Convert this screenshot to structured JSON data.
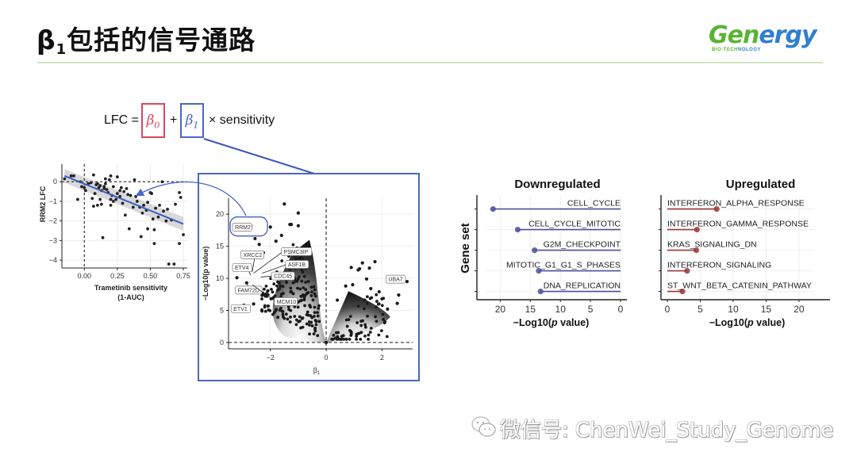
{
  "slide": {
    "title_symbol": "β",
    "title_subscript": "1",
    "title_text": "包括的信号通路",
    "logo": {
      "word_part1": "Gen",
      "word_part2": "ergy",
      "tagline_part1": "BIO-TECH",
      "tagline_part2": "NOLOGY",
      "green": "#5bb234",
      "blue": "#2f7fd0"
    },
    "formula": {
      "lhs": "LFC =",
      "beta0": "β",
      "beta0_sub": "0",
      "plus": "+",
      "beta1": "β",
      "beta1_sub": "1",
      "rhs": "× sensitivity",
      "beta0_color": "#e0455b",
      "beta1_color": "#4a67c4"
    },
    "watermark": "微信号: ChenWei_Study_Genome",
    "watermark_icon": "wechat-icon"
  },
  "chart_data": [
    {
      "id": "scatter",
      "type": "scatter",
      "title": "",
      "xlabel": "Trametinib sensitivity",
      "xlabel2": "(1-AUC)",
      "ylabel": "RRM2 LFC",
      "xlim": [
        -0.17,
        0.78
      ],
      "ylim": [
        -4.4,
        0.9
      ],
      "xticks": [
        "0.00",
        "0.25",
        "0.50",
        "0.75"
      ],
      "xtick_values": [
        0,
        0.25,
        0.5,
        0.75
      ],
      "yticks": [
        "0",
        "−1",
        "−2",
        "−3",
        "−4"
      ],
      "ytick_values": [
        0,
        -1,
        -2,
        -3,
        -4
      ],
      "reference_lines": {
        "x": 0,
        "y": 0
      },
      "fit_line": {
        "x0": -0.15,
        "y0": 0.3,
        "x1": 0.75,
        "y1": -2.15,
        "color": "#3c5fc0"
      },
      "points": [
        [
          -0.15,
          0.15
        ],
        [
          -0.1,
          0.3
        ],
        [
          -0.08,
          0.3
        ],
        [
          -0.05,
          -0.9
        ],
        [
          -0.03,
          0.0
        ],
        [
          0.0,
          -0.3
        ],
        [
          0.01,
          -0.45
        ],
        [
          0.03,
          -0.1
        ],
        [
          0.05,
          -0.05
        ],
        [
          0.06,
          -0.85
        ],
        [
          0.07,
          0.35
        ],
        [
          0.07,
          -1.25
        ],
        [
          0.08,
          -0.6
        ],
        [
          0.09,
          -0.15
        ],
        [
          0.1,
          -1.2
        ],
        [
          0.1,
          -0.1
        ],
        [
          0.11,
          -0.3
        ],
        [
          0.12,
          -0.2
        ],
        [
          0.12,
          -0.9
        ],
        [
          0.13,
          -1.15
        ],
        [
          0.13,
          -0.45
        ],
        [
          0.14,
          -2.85
        ],
        [
          0.15,
          -0.25
        ],
        [
          0.15,
          -0.35
        ],
        [
          0.16,
          0.15
        ],
        [
          0.16,
          -0.1
        ],
        [
          0.17,
          -0.4
        ],
        [
          0.18,
          -0.55
        ],
        [
          0.19,
          0.1
        ],
        [
          0.2,
          -0.9
        ],
        [
          0.2,
          -1.2
        ],
        [
          0.2,
          0.3
        ],
        [
          0.21,
          -0.7
        ],
        [
          0.22,
          -1.0
        ],
        [
          0.22,
          -0.25
        ],
        [
          0.24,
          -0.9
        ],
        [
          0.25,
          0.25
        ],
        [
          0.25,
          -0.6
        ],
        [
          0.27,
          -0.45
        ],
        [
          0.27,
          -0.75
        ],
        [
          0.28,
          -0.3
        ],
        [
          0.29,
          -1.1
        ],
        [
          0.3,
          -0.5
        ],
        [
          0.31,
          -1.7
        ],
        [
          0.32,
          -0.35
        ],
        [
          0.33,
          -0.65
        ],
        [
          0.34,
          -2.4
        ],
        [
          0.35,
          -0.7
        ],
        [
          0.37,
          -1.3
        ],
        [
          0.38,
          0.1
        ],
        [
          0.39,
          -0.75
        ],
        [
          0.4,
          -1.0
        ],
        [
          0.42,
          -1.3
        ],
        [
          0.43,
          -2.8
        ],
        [
          0.44,
          -1.6
        ],
        [
          0.45,
          -1.2
        ],
        [
          0.47,
          -1.45
        ],
        [
          0.48,
          -2.4
        ],
        [
          0.48,
          -1.05
        ],
        [
          0.5,
          -0.55
        ],
        [
          0.51,
          -0.6
        ],
        [
          0.52,
          -1.9
        ],
        [
          0.53,
          -3.15
        ],
        [
          0.53,
          -2.45
        ],
        [
          0.54,
          -1.35
        ],
        [
          0.56,
          -1.8
        ],
        [
          0.57,
          -1.2
        ],
        [
          0.59,
          0.0
        ],
        [
          0.6,
          -1.5
        ],
        [
          0.62,
          -2.0
        ],
        [
          0.63,
          -1.4
        ],
        [
          0.64,
          -4.2
        ],
        [
          0.66,
          -1.95
        ],
        [
          0.68,
          -4.2
        ],
        [
          0.69,
          -1.15
        ],
        [
          0.72,
          -0.55
        ],
        [
          0.72,
          -3.15
        ],
        [
          0.73,
          -0.8
        ],
        [
          0.75,
          -2.7
        ],
        [
          -0.02,
          -0.25
        ]
      ]
    },
    {
      "id": "volcano",
      "type": "scatter",
      "title": "",
      "xlabel": "β",
      "xlabel_sub": "1",
      "ylabel": "−Log10(p value)",
      "xlim": [
        -3.5,
        3.1
      ],
      "ylim": [
        -1.0,
        22.5
      ],
      "xticks": [
        "−2",
        "0",
        "2"
      ],
      "xtick_values": [
        -2,
        0,
        2
      ],
      "yticks": [
        "0",
        "5",
        "10",
        "15",
        "20"
      ],
      "ytick_values": [
        0,
        5,
        10,
        15,
        20
      ],
      "reference_lines": {
        "x": 0,
        "y": 0
      },
      "highlight": {
        "label": "RRM2",
        "color": "#4a67c4"
      },
      "labels": [
        {
          "text": "RRM2",
          "x": -2.7,
          "y": 18.2,
          "lx": -3.3,
          "ly": 17.6
        },
        {
          "text": "XRCC2",
          "x": -2.65,
          "y": 11.0,
          "lx": -3.0,
          "ly": 13.3
        },
        {
          "text": "PSMC3IP",
          "x": -2.6,
          "y": 10.8,
          "lx": -1.55,
          "ly": 13.8
        },
        {
          "text": "ETV4",
          "x": -2.7,
          "y": 10.5,
          "lx": -3.3,
          "ly": 11.3
        },
        {
          "text": "ASF1B",
          "x": -2.3,
          "y": 10.8,
          "lx": -1.4,
          "ly": 11.8
        },
        {
          "text": "CDC45",
          "x": -2.35,
          "y": 10.2,
          "lx": -1.9,
          "ly": 10.0
        },
        {
          "text": "FAM72D",
          "x": -2.85,
          "y": 9.3,
          "lx": -3.2,
          "ly": 7.8
        },
        {
          "text": "MCM10",
          "x": -2.65,
          "y": 9.0,
          "lx": -1.8,
          "ly": 6.0
        },
        {
          "text": "ETV1",
          "x": -2.95,
          "y": 5.8,
          "lx": -3.35,
          "ly": 4.9
        },
        {
          "text": "UBA7",
          "x": 2.85,
          "y": 9.5,
          "lx": 2.2,
          "ly": 9.5
        }
      ],
      "outlier_points": [
        [
          -1.5,
          21.6
        ],
        [
          -1.0,
          20.2
        ],
        [
          -2.7,
          18.2
        ],
        [
          -2.0,
          18.0
        ],
        [
          -1.3,
          18.4
        ],
        [
          -1.25,
          18.4
        ],
        [
          -1.0,
          18.2
        ],
        [
          -2.55,
          16.2
        ],
        [
          -1.6,
          16.7
        ],
        [
          -2.4,
          15.3
        ],
        [
          -1.8,
          15.8
        ],
        [
          -2.25,
          14.0
        ],
        [
          -3.2,
          10.1
        ],
        [
          -2.95,
          5.8
        ],
        [
          -2.85,
          9.3
        ],
        [
          -2.6,
          6.0
        ],
        [
          -2.3,
          4.9
        ],
        [
          0.9,
          11.7
        ],
        [
          1.15,
          11.3
        ],
        [
          1.3,
          12.4
        ],
        [
          1.55,
          11.6
        ],
        [
          1.75,
          12.6
        ],
        [
          1.2,
          11.5
        ],
        [
          1.45,
          9.9
        ],
        [
          0.7,
          8.8
        ],
        [
          0.95,
          9.0
        ],
        [
          1.6,
          8.4
        ],
        [
          1.9,
          7.9
        ],
        [
          2.9,
          9.5
        ],
        [
          2.6,
          7.4
        ],
        [
          2.55,
          6.1
        ],
        [
          0.4,
          6.6
        ],
        [
          2.0,
          6.8
        ],
        [
          2.2,
          5.2
        ]
      ]
    },
    {
      "id": "downregulated",
      "type": "bar",
      "subtype": "lollipop",
      "title": "Downregulated",
      "xlabel": "−Log10(p value)",
      "ylabel": "Gene set",
      "xlim": [
        22.3,
        0
      ],
      "xticks": [
        "20",
        "15",
        "10",
        "5",
        "0"
      ],
      "xtick_values": [
        20,
        15,
        10,
        5,
        0
      ],
      "color": "#4a4f9a",
      "categories": [
        "CELL_CYCLE",
        "CELL_CYCLE_MITOTIC",
        "G2M_CHECKPOINT",
        "MITOTIC_G1_G1_S_PHASES",
        "DNA_REPLICATION"
      ],
      "values": [
        21.2,
        17.1,
        14.3,
        13.6,
        13.3
      ]
    },
    {
      "id": "upregulated",
      "type": "bar",
      "subtype": "lollipop",
      "title": "Upregulated",
      "xlabel": "−Log10(p value)",
      "ylabel": "",
      "xlim": [
        0,
        22.3
      ],
      "xticks": [
        "0",
        "5",
        "10",
        "15",
        "20"
      ],
      "xtick_values": [
        0,
        5,
        10,
        15,
        20
      ],
      "color": "#9b3535",
      "categories": [
        "INTERFERON_ALPHA_RESPONSE",
        "INTERFERON_GAMMA_RESPONSE",
        "KRAS_SIGNALING_DN",
        "INTERFERON_SIGNALING",
        "ST_WNT_BETA_CATENIN_PATHWAY"
      ],
      "values": [
        7.5,
        4.5,
        4.4,
        3.0,
        2.3
      ]
    }
  ]
}
